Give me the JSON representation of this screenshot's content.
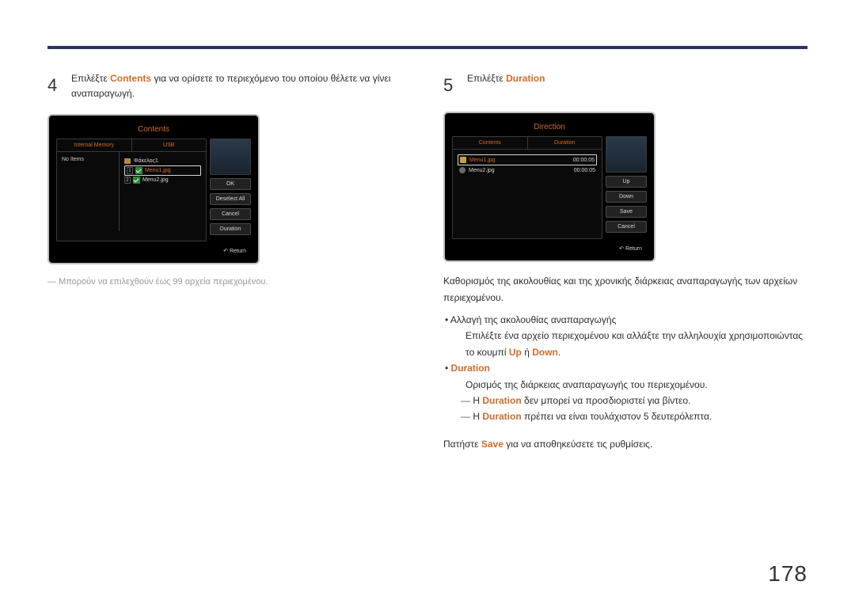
{
  "page_number": "178",
  "step4": {
    "num": "4",
    "text_a": "Επιλέξτε ",
    "text_b": " για να ορίσετε το περιεχόμενο του οποίου θέλετε να γίνει αναπαραγωγή.",
    "contents_word": "Contents",
    "note": "Μπορούν να επιλεχθούν έως 99 αρχεία περιεχομένου."
  },
  "contents_screen": {
    "title": "Contents",
    "tab_left": "Internal Memory",
    "tab_right": "USB",
    "no_items": "No Items",
    "folder": "Φάκελος1",
    "item1_idx": "1",
    "item1_name": "Menu1.jpg",
    "item2_idx": "2",
    "item2_name": "Menu2.jpg",
    "btn_ok": "OK",
    "btn_deselect": "Deselect All",
    "btn_cancel": "Cancel",
    "btn_duration": "Duration",
    "return": "Return"
  },
  "step5": {
    "num": "5",
    "text_a": "Επιλέξτε ",
    "duration_word": "Duration"
  },
  "direction_screen": {
    "title": "Direction",
    "tab_left": "Contents",
    "tab_right": "Duration",
    "row1_name": "Menu1.jpg",
    "row1_dur": "00:00:05",
    "row2_name": "Menu2.jpg",
    "row2_dur": "00:00:05",
    "btn_up": "Up",
    "btn_down": "Down",
    "btn_save": "Save",
    "btn_cancel": "Cancel",
    "return": "Return"
  },
  "right": {
    "p1": "Καθορισμός της ακολουθίας και της χρονικής διάρκειας αναπαραγωγής των αρχείων περιεχομένου.",
    "b1": "Αλλαγή της ακολουθίας αναπαραγωγής",
    "b1_sub_a": "Επιλέξτε ένα αρχείο περιεχομένου και αλλάξτε την αλληλουχία χρησιμοποιώντας το κουμπί ",
    "up": "Up",
    "or": " ή ",
    "down": "Down",
    "dot": ".",
    "b2": "Duration",
    "b2_sub": "Ορισμός της διάρκειας αναπαραγωγής του περιεχομένου.",
    "dash1_a": "Η ",
    "dash1_b": " δεν μπορεί να προσδιοριστεί για βίντεο.",
    "dash2_a": "Η ",
    "dash2_b": " πρέπει να είναι τουλάχιστον 5 δευτερόλεπτα.",
    "p2_a": "Πατήστε ",
    "save": "Save",
    "p2_b": " για να αποθηκεύσετε τις ρυθμίσεις."
  }
}
